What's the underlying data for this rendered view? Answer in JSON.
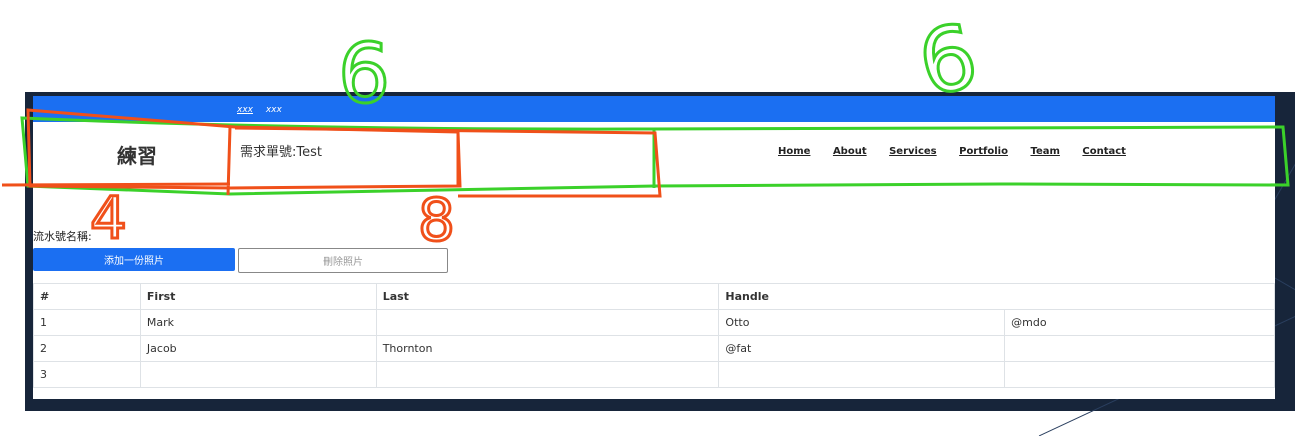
{
  "topbar": {
    "link1": "xxx",
    "link2": "xxx"
  },
  "header": {
    "brand": "練習",
    "request_no": "需求單號:Test",
    "nav": [
      "Home",
      "About",
      "Services",
      "Portfolio",
      "Team",
      "Contact"
    ]
  },
  "form": {
    "serial_label": "流水號名稱:",
    "add_button": "添加一份照片",
    "delete_button": "刪除照片"
  },
  "table": {
    "headers": [
      "#",
      "First",
      "Last",
      "Handle"
    ],
    "rows": [
      [
        "1",
        "Mark",
        "",
        "Otto",
        "@mdo"
      ],
      [
        "2",
        "Jacob",
        "Thornton",
        "@fat",
        ""
      ],
      [
        "3",
        "",
        "",
        "",
        ""
      ]
    ]
  },
  "annotations": {
    "label_a": "6",
    "label_b": "6",
    "label_c": "4",
    "label_d": "8"
  },
  "colors": {
    "accent": "#1b6ff2",
    "annotation_green": "#3bd12a",
    "annotation_orange": "#f0501a",
    "wallpaper": "#17253a"
  }
}
